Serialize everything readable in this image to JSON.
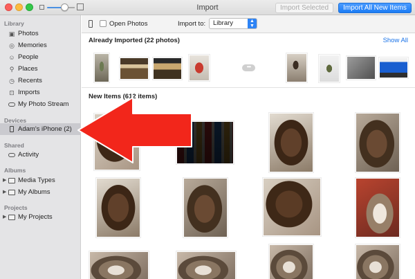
{
  "window": {
    "title": "Import",
    "import_selected": "Import Selected",
    "import_all": "Import All New Items"
  },
  "sidebar": {
    "library_head": "Library",
    "library_items": [
      {
        "label": "Photos",
        "icon": "photos-icon"
      },
      {
        "label": "Memories",
        "icon": "memories-icon"
      },
      {
        "label": "People",
        "icon": "people-icon"
      },
      {
        "label": "Places",
        "icon": "places-icon"
      },
      {
        "label": "Recents",
        "icon": "clock-icon"
      },
      {
        "label": "Imports",
        "icon": "imports-icon"
      },
      {
        "label": "My Photo Stream",
        "icon": "cloud-icon"
      }
    ],
    "devices_head": "Devices",
    "device_label": "Adam's iPhone (2)",
    "shared_head": "Shared",
    "shared_item": "Activity",
    "albums_head": "Albums",
    "albums_items": [
      "Media Types",
      "My Albums"
    ],
    "projects_head": "Projects",
    "projects_item": "My Projects"
  },
  "toolbar": {
    "open_photos": "Open Photos",
    "import_to_label": "Import to:",
    "import_to_value": "Library"
  },
  "main": {
    "already_imported": "Already Imported (22 photos)",
    "show_all": "Show All",
    "new_items": "New Items (612 items)"
  },
  "colors": {
    "accent": "#1b7cf5",
    "arrow": "#f2261b",
    "sidebar_bg": "#e4e4e6"
  }
}
